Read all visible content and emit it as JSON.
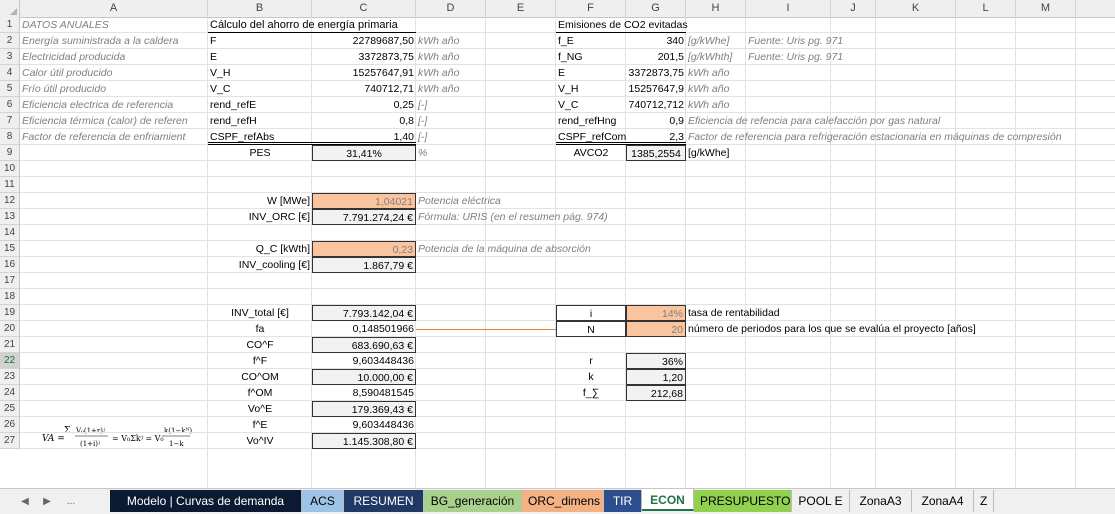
{
  "columns": [
    "A",
    "B",
    "C",
    "D",
    "E",
    "F",
    "G",
    "H",
    "I",
    "J",
    "K",
    "L",
    "M"
  ],
  "rows": [
    "1",
    "2",
    "3",
    "4",
    "5",
    "6",
    "7",
    "8",
    "9",
    "10",
    "11",
    "12",
    "13",
    "14",
    "15",
    "16",
    "17",
    "18",
    "19",
    "20",
    "21",
    "22",
    "23",
    "24",
    "25",
    "26",
    "27"
  ],
  "selected_row": "22",
  "colA": {
    "r1": "DATOS ANUALES",
    "r2": "Energía suministrada a la caldera",
    "r3": "Electricidad producida",
    "r4": "Calor útil producido",
    "r5": "Frío útil producido",
    "r6": "Eficiencia electrica de referencia",
    "r7": "Eficiencia térmica (calor) de referen",
    "r8": "Factor de referencia de enfriamient"
  },
  "pes_block": {
    "title": "Cálculo del ahorro de energía primaria",
    "rows": [
      {
        "name": "F",
        "value": "22789687,50",
        "unit": "kWh año"
      },
      {
        "name": "E",
        "value": "3372873,75",
        "unit": "kWh año"
      },
      {
        "name": "V_H",
        "value": "15257647,91",
        "unit": "kWh año"
      },
      {
        "name": "V_C",
        "value": "740712,71",
        "unit": "kWh año"
      },
      {
        "name": "rend_refE",
        "value": "0,25",
        "unit": "[-]"
      },
      {
        "name": "rend_refH",
        "value": "0,8",
        "unit": "[-]"
      },
      {
        "name": "CSPF_refAbs",
        "value": "1,40",
        "unit": "[-]"
      }
    ],
    "result_label": "PES",
    "result_value": "31,41%",
    "result_unit": "%"
  },
  "co2_block": {
    "title": "Emisiones de CO2 evitadas",
    "rows": [
      {
        "name": "f_E",
        "value": "340",
        "unit": "[g/kWhe]",
        "note": "Fuente: Uris pg. 971"
      },
      {
        "name": "f_NG",
        "value": "201,5",
        "unit": "[g/kWhth]",
        "note": "Fuente: Uris pg. 971"
      },
      {
        "name": "E",
        "value": "3372873,75",
        "unit": "kWh año",
        "note": ""
      },
      {
        "name": "V_H",
        "value": "15257647,9",
        "unit": "kWh año",
        "note": ""
      },
      {
        "name": "V_C",
        "value": "740712,712",
        "unit": "kWh año",
        "note": ""
      },
      {
        "name": "rend_refHng",
        "value": "0,9",
        "unit": "Eficiencia de refencia para calefacción por gas natural",
        "note": ""
      },
      {
        "name": "CSPF_refCom",
        "value": "2,3",
        "unit": "Factor de referencia para refrigeración estacionaria en máquinas de compresión",
        "note": ""
      }
    ],
    "result_label": "AVCO2",
    "result_value": "1385,2554",
    "result_unit": "[g/kWhe]"
  },
  "econ": {
    "w_label": "W [MWe]",
    "w_value": "1,04021",
    "w_note": "Potencia eléctrica",
    "inv_orc_label": "INV_ORC [€]",
    "inv_orc_value": "7.791.274,24 €",
    "inv_orc_note": "Fórmula: URIS (en el resumen pág. 974)",
    "qc_label": "Q_C [kWth]",
    "qc_value": "0,23",
    "qc_note": "Potencia de la máquina de absorción",
    "inv_cool_label": "INV_cooling [€]",
    "inv_cool_value": "1.867,79 €",
    "list": [
      {
        "label": "INV_total [€]",
        "value": "7.793.142,04 €",
        "boxed": true
      },
      {
        "label": "fa",
        "value": "0,148501966",
        "boxed": false
      },
      {
        "label": "CO^F",
        "value": "683.690,63 €",
        "boxed": true
      },
      {
        "label": "f^F",
        "value": "9,603448436",
        "boxed": false
      },
      {
        "label": "CO^OM",
        "value": "10.000,00 €",
        "boxed": true
      },
      {
        "label": "f^OM",
        "value": "8,590481545",
        "boxed": false
      },
      {
        "label": "Vo^E",
        "value": "179.369,43 €",
        "boxed": true
      },
      {
        "label": "f^E",
        "value": "9,603448436",
        "boxed": false
      },
      {
        "label": "Vo^IV",
        "value": "1.145.308,80 €",
        "boxed": true
      }
    ],
    "i_label": "i",
    "i_value": "14%",
    "i_note": "tasa de rentabilidad",
    "n_label": "N",
    "n_value": "20",
    "n_note": "número de periodos para los que se evalúa el proyecto [años]",
    "r_label": "r",
    "r_value": "36%",
    "k_label": "k",
    "k_value": "1,20",
    "fs_label": "f_∑",
    "fs_value": "212,68"
  },
  "tabs": [
    {
      "label": "Modelo | Curvas de demanda",
      "bg": "#0b1a33",
      "fg": "#ffffff"
    },
    {
      "label": "ACS",
      "bg": "#9dc3e6",
      "fg": "#000000"
    },
    {
      "label": "RESUMEN",
      "bg": "#1f3864",
      "fg": "#ffffff"
    },
    {
      "label": "BG_generación",
      "bg": "#a9d18e",
      "fg": "#000000"
    },
    {
      "label": "ORC_dimens",
      "bg": "#f4b183",
      "fg": "#000000"
    },
    {
      "label": "TIR",
      "bg": "#2e4f8f",
      "fg": "#ffffff"
    },
    {
      "label": "ECON",
      "bg": "#ffffff",
      "fg": "#217346",
      "active": true
    },
    {
      "label": "PRESUPUESTO",
      "bg": "#92d050",
      "fg": "#000000"
    },
    {
      "label": "POOL E",
      "bg": "#f0f0f0",
      "fg": "#000000"
    },
    {
      "label": "ZonaA3",
      "bg": "#f0f0f0",
      "fg": "#000000"
    },
    {
      "label": "ZonaA4",
      "bg": "#f0f0f0",
      "fg": "#000000"
    },
    {
      "label": "Z",
      "bg": "#f0f0f0",
      "fg": "#000000"
    }
  ],
  "nav": {
    "prev": "◀",
    "next": "▶",
    "more": "..."
  }
}
